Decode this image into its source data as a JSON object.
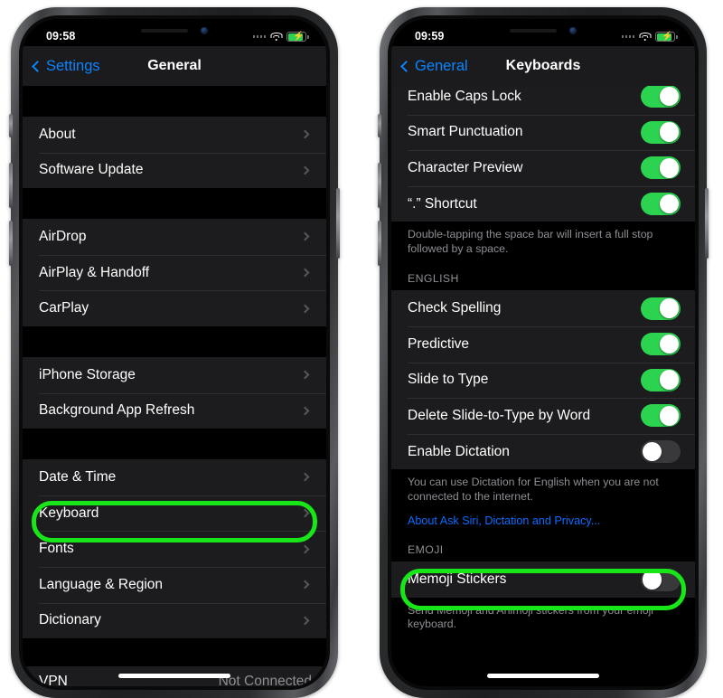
{
  "left_phone": {
    "status_bar": {
      "time": "09:58",
      "signal_icon": "signal-dots-icon",
      "wifi_icon": "wifi-icon",
      "battery_icon": "battery-charging-icon",
      "battery_color": "#2CD350"
    },
    "nav": {
      "back_label": "Settings",
      "back_icon": "chevron-left-icon",
      "title": "General",
      "accent_color": "#0A84FF"
    },
    "groups": [
      {
        "rows": [
          {
            "label": "About",
            "accessory": "chevron-right-icon"
          },
          {
            "label": "Software Update",
            "accessory": "chevron-right-icon"
          }
        ]
      },
      {
        "rows": [
          {
            "label": "AirDrop",
            "accessory": "chevron-right-icon"
          },
          {
            "label": "AirPlay & Handoff",
            "accessory": "chevron-right-icon"
          },
          {
            "label": "CarPlay",
            "accessory": "chevron-right-icon"
          }
        ]
      },
      {
        "rows": [
          {
            "label": "iPhone Storage",
            "accessory": "chevron-right-icon"
          },
          {
            "label": "Background App Refresh",
            "accessory": "chevron-right-icon"
          }
        ]
      },
      {
        "rows": [
          {
            "label": "Date & Time",
            "accessory": "chevron-right-icon"
          },
          {
            "label": "Keyboard",
            "accessory": "chevron-right-icon",
            "highlighted": true
          },
          {
            "label": "Fonts",
            "accessory": "chevron-right-icon"
          },
          {
            "label": "Language & Region",
            "accessory": "chevron-right-icon"
          },
          {
            "label": "Dictionary",
            "accessory": "chevron-right-icon"
          }
        ]
      }
    ],
    "peek_row": {
      "label": "VPN",
      "value": "Not Connected"
    },
    "home_indicator": "home-indicator"
  },
  "right_phone": {
    "status_bar": {
      "time": "09:59",
      "signal_icon": "signal-dots-icon",
      "wifi_icon": "wifi-icon",
      "battery_icon": "battery-charging-icon",
      "battery_color": "#2CD350"
    },
    "nav": {
      "back_label": "General",
      "back_icon": "chevron-left-icon",
      "title": "Keyboards",
      "accent_color": "#0A84FF"
    },
    "top_group": {
      "rows": [
        {
          "label": "Enable Caps Lock",
          "toggle": "on",
          "clipped": true
        },
        {
          "label": "Smart Punctuation",
          "toggle": "on"
        },
        {
          "label": "Character Preview",
          "toggle": "on"
        },
        {
          "label": "“.” Shortcut",
          "toggle": "on"
        }
      ],
      "footnote": "Double-tapping the space bar will insert a full stop followed by a space."
    },
    "english_section": {
      "header": "ENGLISH",
      "rows": [
        {
          "label": "Check Spelling",
          "toggle": "on"
        },
        {
          "label": "Predictive",
          "toggle": "on"
        },
        {
          "label": "Slide to Type",
          "toggle": "on"
        },
        {
          "label": "Delete Slide-to-Type by Word",
          "toggle": "on"
        },
        {
          "label": "Enable Dictation",
          "toggle": "off"
        }
      ],
      "footnote": "You can use Dictation for English when you are not connected to the internet.",
      "link": "About Ask Siri, Dictation and Privacy..."
    },
    "emoji_section": {
      "header": "EMOJI",
      "rows": [
        {
          "label": "Memoji Stickers",
          "toggle": "off",
          "highlighted": true
        }
      ],
      "footnote": "Send Memoji and Animoji stickers from your emoji keyboard."
    },
    "home_indicator": "home-indicator"
  },
  "annotations": {
    "highlight_color": "#19E619",
    "items": [
      {
        "target": "Keyboard",
        "phone": "left"
      },
      {
        "target": "Memoji Stickers",
        "phone": "right"
      }
    ]
  }
}
